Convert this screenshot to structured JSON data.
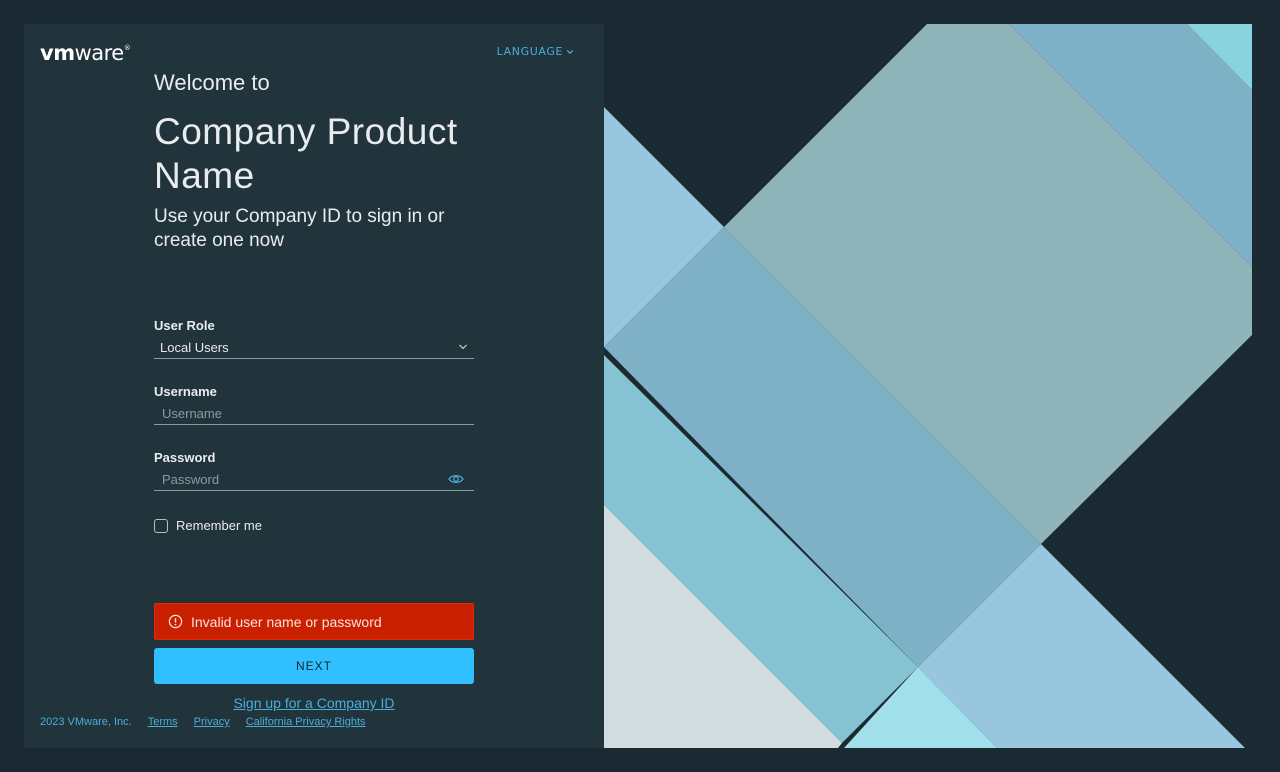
{
  "brand": {
    "logo_vm": "vm",
    "logo_ware": "ware",
    "logo_reg": "®"
  },
  "language": {
    "label": "LANGUAGE"
  },
  "heading": {
    "welcome": "Welcome to",
    "product": "Company Product Name",
    "tagline": "Use your Company ID to sign in or create one now"
  },
  "form": {
    "role_label": "User Role",
    "role_value": "Local Users",
    "username_label": "Username",
    "username_placeholder": "Username",
    "username_value": "",
    "password_label": "Password",
    "password_placeholder": "Password",
    "password_value": "",
    "remember_label": "Remember me",
    "remember_checked": false
  },
  "alert": {
    "message": "Invalid user name or password"
  },
  "actions": {
    "next_label": "NEXT",
    "signup_label": "Sign up for a Company ID"
  },
  "footer": {
    "copyright": "2023 VMware, Inc.",
    "links": [
      "Terms",
      "Privacy",
      "California Privacy Rights"
    ]
  },
  "colors": {
    "background": "#1b2a32",
    "panel": "#21333b",
    "accent": "#30c0ff",
    "link": "#49afd9",
    "error": "#c92100"
  },
  "icons": {
    "language_chevron": "chevron-down-icon",
    "role_chevron": "chevron-down-icon",
    "password_toggle": "eye-icon",
    "alert": "exclamation-circle-icon"
  }
}
